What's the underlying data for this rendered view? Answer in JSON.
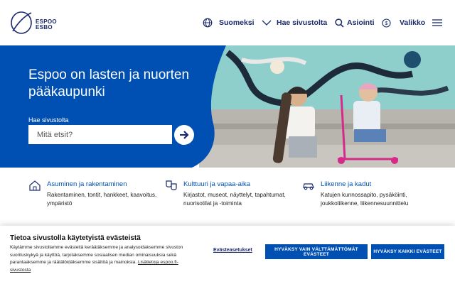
{
  "header": {
    "logo_line1": "ESPOO",
    "logo_line2": "ESBO",
    "language_label": "Suomeksi",
    "search_label": "Hae sivustolta",
    "services_label": "Asiointi",
    "menu_label": "Valikko"
  },
  "hero": {
    "title": "Espoo on lasten ja nuorten pääkaupunki",
    "search_label": "Hae sivustolta",
    "search_placeholder": "Mitä etsit?"
  },
  "categories": [
    {
      "title": "Asuminen ja rakentaminen",
      "description": "Rakentaminen, tontit, hankkeet, kaavoitus, ympäristö",
      "icon": "house-icon"
    },
    {
      "title": "Kulttuuri ja vapaa-aika",
      "description": "Kirjastot, museot, näyttelyt, tapahtumat, nuorisotilat ja -toiminta",
      "icon": "theater-masks-icon"
    },
    {
      "title": "Liikenne ja kadut",
      "description": "Katujen kunnossapito, pysäköinti, joukkoliikenne, liikennesuunnittelu",
      "icon": "car-icon"
    }
  ],
  "cookie": {
    "title": "Tietoa sivustolla käytetyistä evästeistä",
    "text": "Käytämme sivustollamme evästeitä keräätäksemme ja analysoidaksemme sivuston suorituskykyä ja käyttöä, tarjotaksemme sosiaalisen median ominaisuuksia sekä parantaaksemme ja räätälöidäksemme sisältöä ja mainoksia.",
    "link": "Lisätietoja espoo.fi-sivustosta",
    "settings_label": "Evästeasetukset",
    "necessary_button": "HYVÄKSY VAIN VÄLTTÄMÄTTÖMÄT EVÄSTEET",
    "all_button": "HYVÄKSY KAIKKI EVÄSTEET"
  },
  "colors": {
    "brand_blue": "#0050b4",
    "navy": "#1a2a6c"
  }
}
